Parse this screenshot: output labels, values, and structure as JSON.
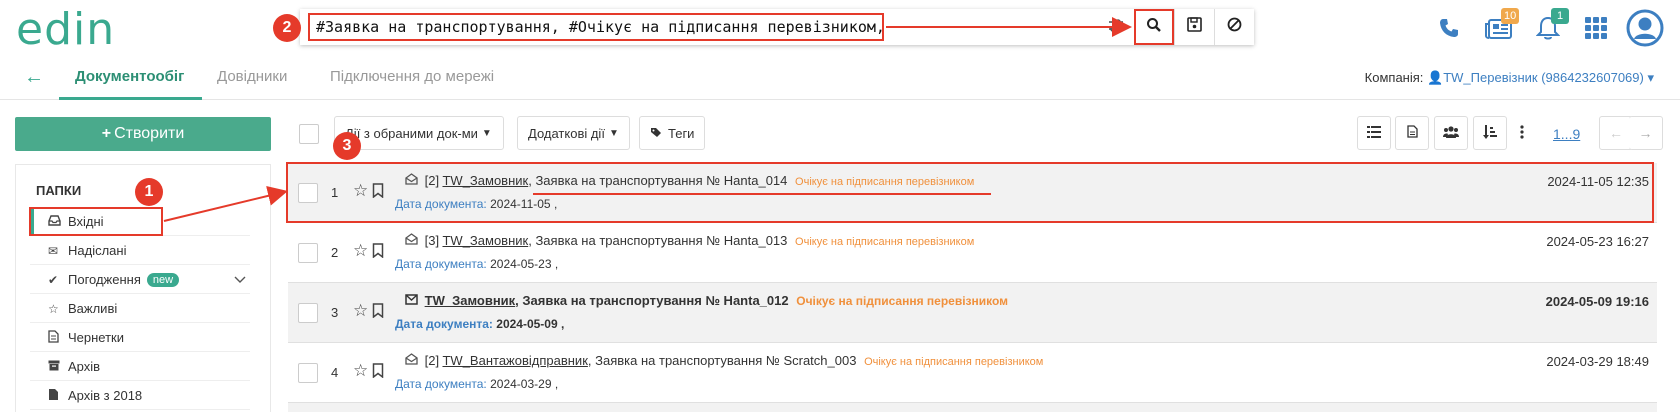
{
  "header": {
    "logo": "edin",
    "search_query": "#Заявка на транспортування, #Очікує на підписання перевізником,",
    "archive_badge": "10",
    "bell_badge": "1"
  },
  "icons": {
    "filter": "sliders-icon",
    "search": "search-icon",
    "save": "floppy-icon",
    "clear": "ban-icon",
    "phone": "phone-icon",
    "archive": "newspaper-icon",
    "bell": "bell-icon",
    "apps": "grid-icon",
    "user": "user-avatar-icon"
  },
  "nav": {
    "back": "←",
    "tabs": [
      {
        "label": "Документообіг",
        "active": true
      },
      {
        "label": "Довідники",
        "active": false
      },
      {
        "label": "Підключення до мережі",
        "active": false
      }
    ],
    "company_label": "Компанія:",
    "company_value": "TW_Перевізник (9864232607069)"
  },
  "sidebar": {
    "create_label": "Створити",
    "folders_title": "ПАПКИ",
    "folders": [
      {
        "label": "Вхідні",
        "icon": "inbox-icon"
      },
      {
        "label": "Надіслані",
        "icon": "envelope-icon"
      },
      {
        "label": "Погодження",
        "icon": "check-icon",
        "badge": "new"
      },
      {
        "label": "Важливі",
        "icon": "star-icon"
      },
      {
        "label": "Чернетки",
        "icon": "document-icon"
      },
      {
        "label": "Архів",
        "icon": "archive-icon"
      },
      {
        "label": "Архів з 2018",
        "icon": "file-icon"
      }
    ]
  },
  "toolbar": {
    "bulk_actions": "Дії з обраними док-ми",
    "extra_actions": "Додаткові дії",
    "tags": "Теги",
    "pager": "1...9"
  },
  "documents": [
    {
      "num": "1",
      "count": "[2]",
      "sender": "TW_Замовник",
      "title": "Заявка на транспортування № Hanta_014",
      "status": "Очікує на підписання перевізником",
      "date_label": "Дата документа:",
      "doc_date": "2024-11-05",
      "datetime": "2024-11-05 12:35",
      "unread": false
    },
    {
      "num": "2",
      "count": "[3]",
      "sender": "TW_Замовник",
      "title": "Заявка на транспортування № Hanta_013",
      "status": "Очікує на підписання перевізником",
      "date_label": "Дата документа:",
      "doc_date": "2024-05-23",
      "datetime": "2024-05-23 16:27",
      "unread": false
    },
    {
      "num": "3",
      "count": "",
      "sender": "TW_Замовник",
      "title": "Заявка на транспортування № Hanta_012",
      "status": "Очікує на підписання перевізником",
      "date_label": "Дата документа:",
      "doc_date": "2024-05-09",
      "datetime": "2024-05-09 19:16",
      "unread": true
    },
    {
      "num": "4",
      "count": "[2]",
      "sender": "TW_Вантажовідправник",
      "title": "Заявка на транспортування № Scratch_003",
      "status": "Очікує на підписання перевізником",
      "date_label": "Дата документа:",
      "doc_date": "2024-03-29",
      "datetime": "2024-03-29 18:49",
      "unread": false
    }
  ],
  "callouts": [
    "1",
    "2",
    "3"
  ],
  "colors": {
    "accent": "#3aa98f",
    "link": "#3d7fc1",
    "status": "#f0903c",
    "annotation": "#e53a2a"
  }
}
